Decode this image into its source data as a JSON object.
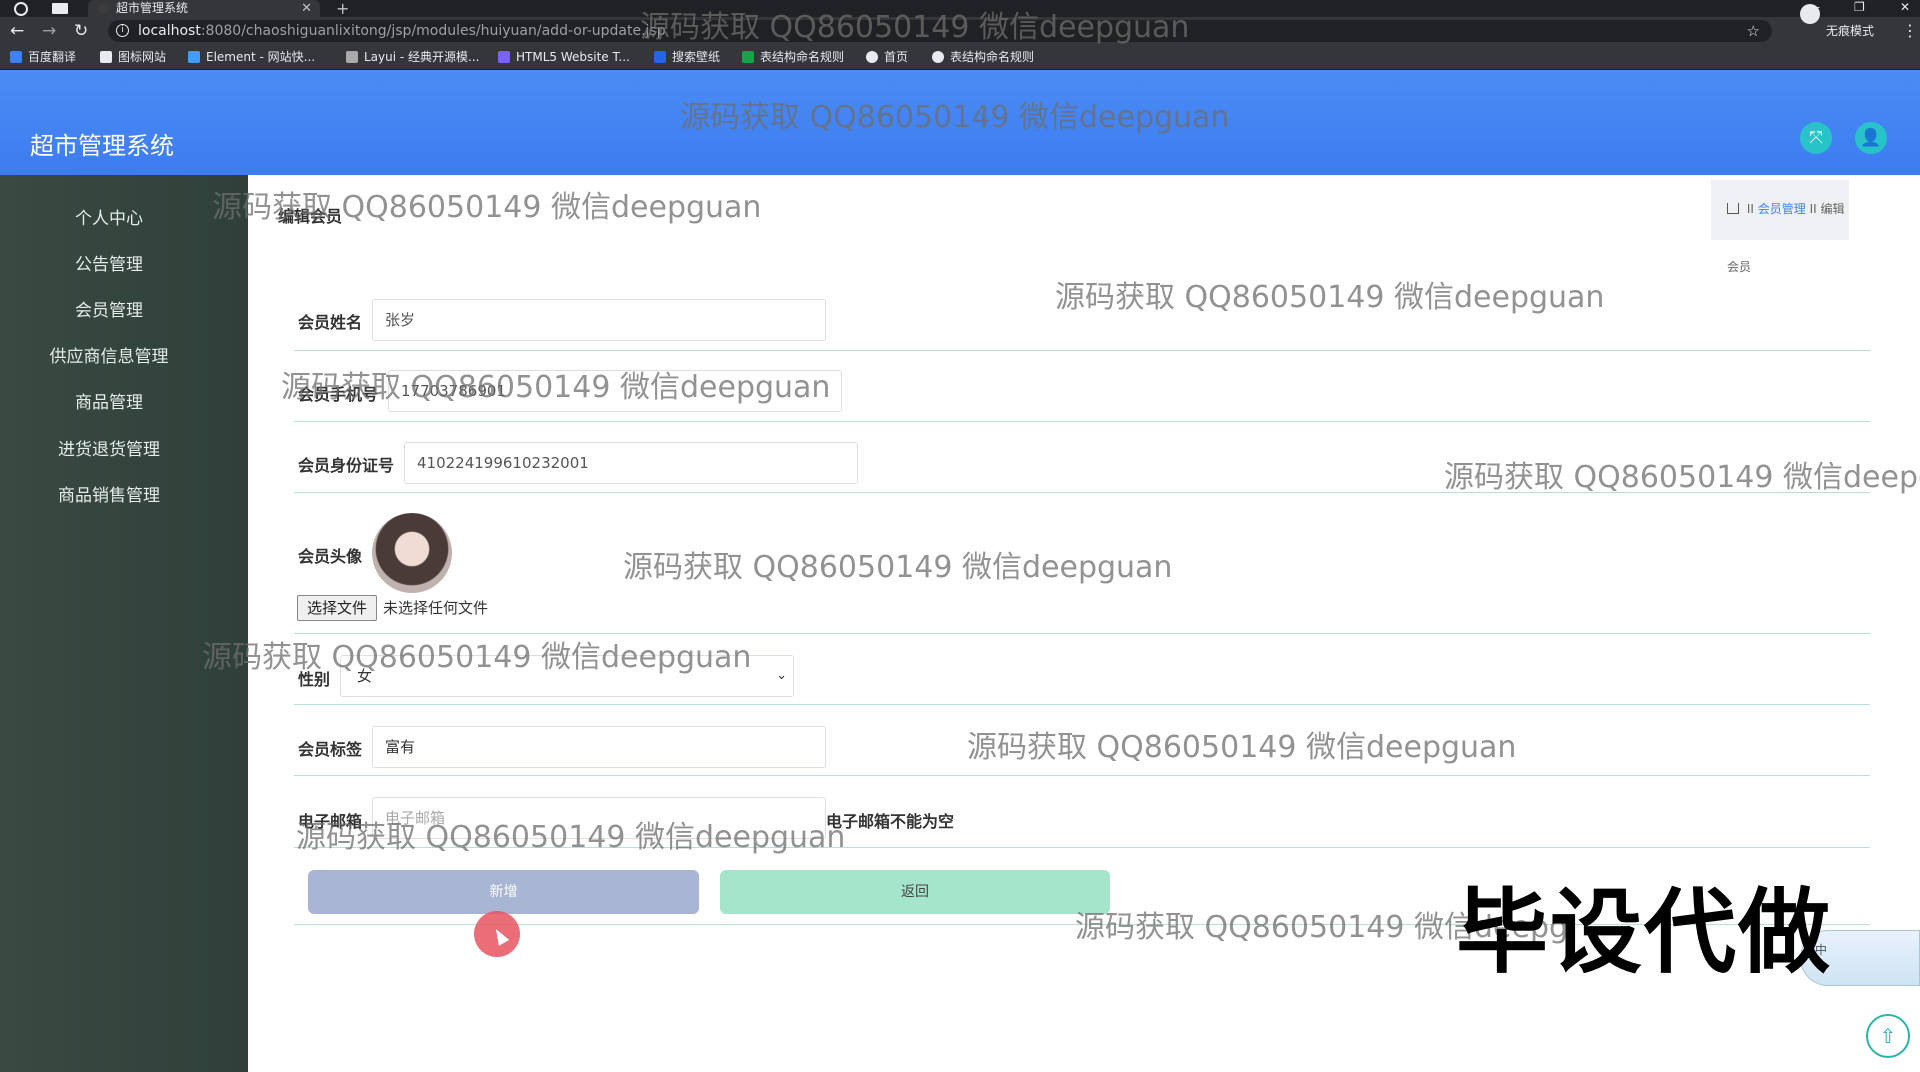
{
  "browser": {
    "tab_title": "超市管理系统",
    "url_host": "localhost",
    "url_rest": ":8080/chaoshiguanlixitong/jsp/modules/huiyuan/add-or-update.jsp",
    "incognito_label": "无痕模式",
    "bookmarks": [
      {
        "label": "百度翻译",
        "color": "#3b82f6"
      },
      {
        "label": "图标网站",
        "color": "#e8eaed"
      },
      {
        "label": "Element - 网站快...",
        "color": "#409eff"
      },
      {
        "label": "Layui - 经典开源模...",
        "color": "#aaaaaa"
      },
      {
        "label": "HTML5 Website T...",
        "color": "#7b61ff"
      },
      {
        "label": "搜索壁纸",
        "color": "#2563eb"
      },
      {
        "label": "表结构命名规则",
        "color": "#16a34a"
      },
      {
        "label": "首页",
        "color": "#e8eaed"
      },
      {
        "label": "表结构命名规则",
        "color": "#e8eaed"
      }
    ]
  },
  "app": {
    "title": "超市管理系统"
  },
  "sidebar": {
    "items": [
      {
        "label": "个人中心"
      },
      {
        "label": "公告管理"
      },
      {
        "label": "会员管理"
      },
      {
        "label": "供应商信息管理"
      },
      {
        "label": "商品管理"
      },
      {
        "label": "进货退货管理"
      },
      {
        "label": "商品销售管理"
      }
    ]
  },
  "page": {
    "title": "编辑会员",
    "breadcrumb": {
      "sep": "II",
      "parent": "会员管理",
      "current": "编辑会员"
    }
  },
  "form": {
    "name": {
      "label": "会员姓名",
      "value": "张岁"
    },
    "phone": {
      "label": "会员手机号",
      "value": "17703786901"
    },
    "idcard": {
      "label": "会员身份证号",
      "value": "410224199610232001"
    },
    "avatar": {
      "label": "会员头像",
      "file_button": "选择文件",
      "file_status": "未选择任何文件"
    },
    "gender": {
      "label": "性别",
      "value": "女"
    },
    "tag": {
      "label": "会员标签",
      "value": "富有"
    },
    "email": {
      "label": "电子邮箱",
      "placeholder": "电子邮箱",
      "error": "电子邮箱不能为空"
    },
    "buttons": {
      "add": "新增",
      "back": "返回"
    }
  },
  "overlays": {
    "watermark": "源码获取 QQ86050149 微信deepguan",
    "watermark_cut": "源码获取 QQ86050149 微信deepg",
    "big_text": "毕设代做",
    "ime_char": "中"
  }
}
